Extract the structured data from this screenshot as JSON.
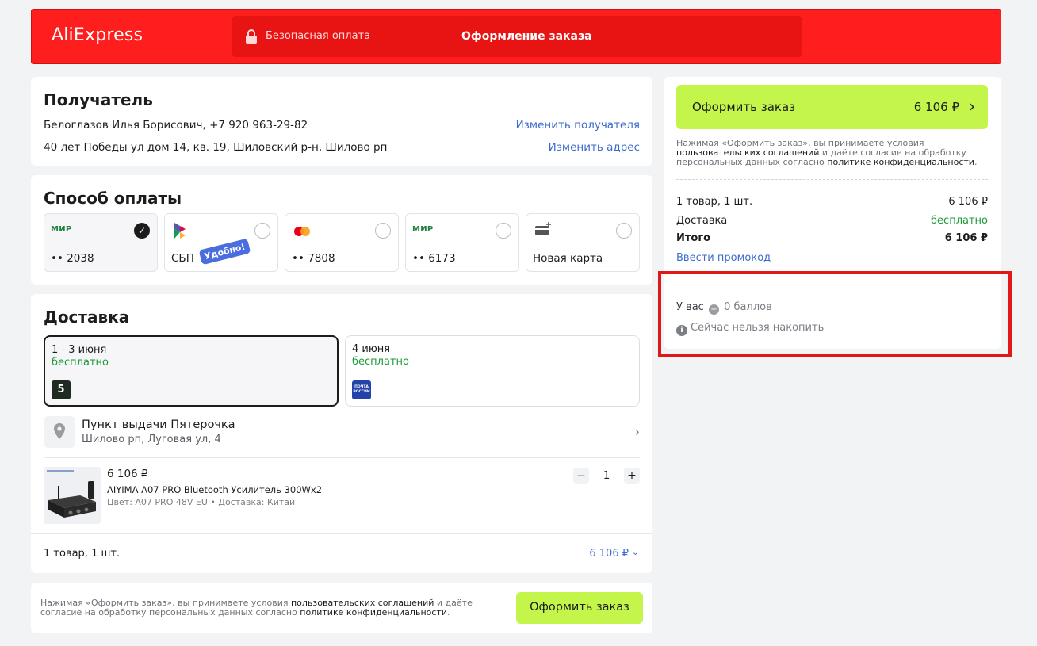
{
  "header": {
    "logo": "AliExpress",
    "secure": "Безопасная оплата",
    "title": "Оформление заказа"
  },
  "recipient": {
    "title": "Получатель",
    "name_phone": "Белоглазов Илья Борисович, +7 920 963-29-82",
    "address": "40 лет Победы ул дом 14, кв. 19, Шиловский р-н, Шилово рп",
    "change_recipient": "Изменить получателя",
    "change_address": "Изменить адрес"
  },
  "payment": {
    "title": "Способ оплаты",
    "options": [
      {
        "brand": "МИР",
        "label": "•• 2038",
        "selected": true
      },
      {
        "brand": "СБП",
        "label": "СБП",
        "badge": "Удобно!"
      },
      {
        "brand": "mastercard",
        "label": "•• 7808"
      },
      {
        "brand": "МИР",
        "label": "•• 6173"
      },
      {
        "brand": "new-card",
        "label": "Новая карта"
      }
    ]
  },
  "delivery": {
    "title": "Доставка",
    "options": [
      {
        "date": "1 - 3 июня",
        "price": "бесплатно",
        "carrier_icon": "5"
      },
      {
        "date": "4 июня",
        "price": "бесплатно",
        "carrier_icon": "ПОЧТА РОССИИ"
      }
    ],
    "pickup_title": "Пункт выдачи Пятерочка",
    "pickup_address": "Шилово рп, Луговая ул, 4",
    "item": {
      "price": "6 106 ₽",
      "name": "AIYIMA A07 PRO Bluetooth Усилитель 300Wx2",
      "meta": "Цвет: A07 PRO 48V EU • Доставка: Китай",
      "qty": "1",
      "minus": "−",
      "plus": "+"
    },
    "summary_count": "1 товар, 1 шт.",
    "summary_total": "6 106 ₽"
  },
  "bottom": {
    "legal_1": "Нажимая «Оформить заказ», вы принимаете условия ",
    "legal_link1": "пользовательских соглашений",
    "legal_2": " и даёте согласие на обработку персональных данных согласно ",
    "legal_link2": "политике конфиденциальности",
    "legal_3": ".",
    "button": "Оформить заказ"
  },
  "sidebar": {
    "button": "Оформить заказ",
    "button_price": "6 106 ₽",
    "legal_1": "Нажимая «Оформить заказ», вы принимаете условия ",
    "legal_link1": "пользовательских соглашений",
    "legal_2": " и даёте согласие на обработку персональных данных согласно ",
    "legal_link2": "политике конфиденциальности",
    "legal_3": ".",
    "goods_label": "1 товар, 1 шт.",
    "goods_value": "6 106 ₽",
    "delivery_label": "Доставка",
    "delivery_value": "бесплатно",
    "total_label": "Итого",
    "total_value": "6 106 ₽",
    "promo": "Ввести промокод",
    "points_prefix": "У вас",
    "points": "0 баллов",
    "points_note": "Сейчас нельзя накопить"
  },
  "colors": {
    "brand_red": "#ff1e1e",
    "accent_green": "#c3f54a",
    "link_blue": "#3d6ccf",
    "free_green": "#1d9b3a",
    "highlight_red": "#e01818"
  }
}
